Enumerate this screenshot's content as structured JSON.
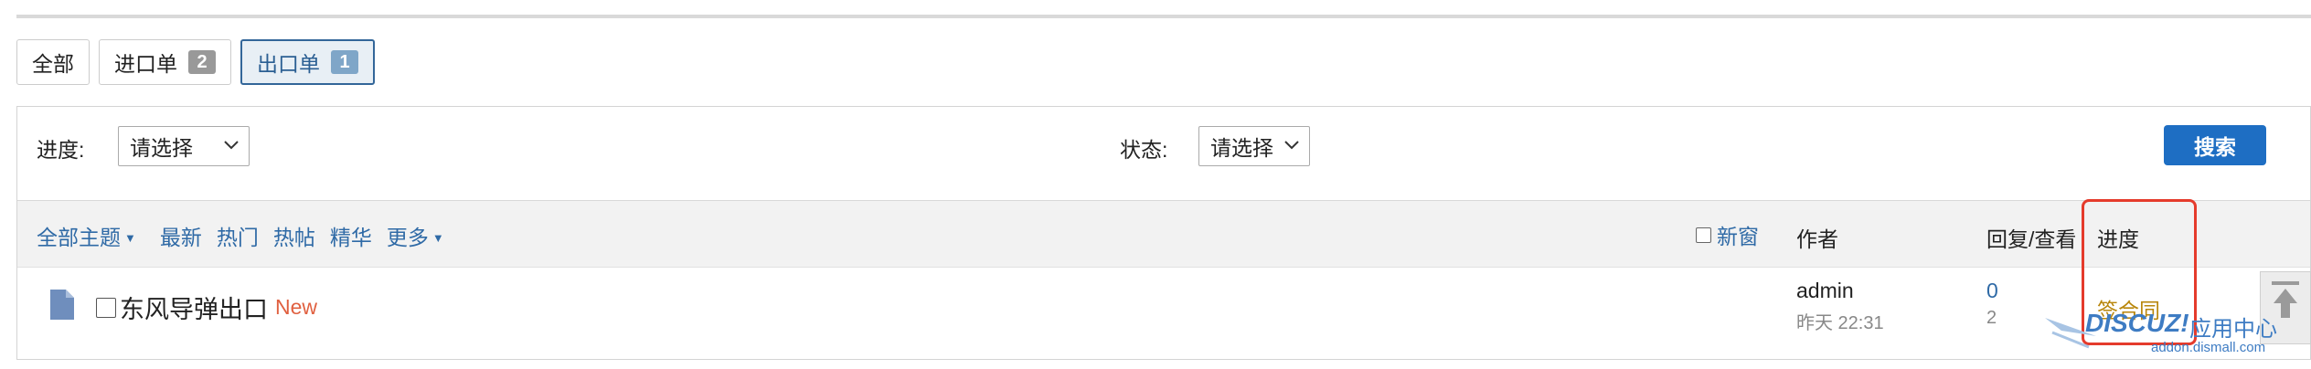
{
  "tabs": [
    {
      "label": "全部",
      "badge": ""
    },
    {
      "label": "进口单",
      "badge": "2"
    },
    {
      "label": "出口单",
      "badge": "1"
    }
  ],
  "filters": {
    "progress_label": "进度:",
    "progress_value": "请选择",
    "status_label": "状态:",
    "status_value": "请选择",
    "search_label": "搜索"
  },
  "nav": {
    "all_topics": "全部主题",
    "latest": "最新",
    "hot": "热门",
    "hot_posts": "热帖",
    "digest": "精华",
    "more": "更多",
    "new_window": "新窗"
  },
  "columns": {
    "author": "作者",
    "reply_view": "回复/查看",
    "progress": "进度"
  },
  "thread": {
    "title": "东风导弹出口",
    "new_tag": "New",
    "author": "admin",
    "time": "昨天 22:31",
    "replies": "0",
    "views": "2",
    "progress": "签合同"
  },
  "watermark": {
    "logo": "DISCUZ!",
    "text": "应用中心",
    "url": "addon.dismall.com"
  },
  "colors": {
    "link": "#2f6aa6",
    "search_button": "#1e6ec3",
    "new_tag": "#e06040",
    "progress_text": "#b8860b",
    "highlight_box": "#e53b2c"
  }
}
